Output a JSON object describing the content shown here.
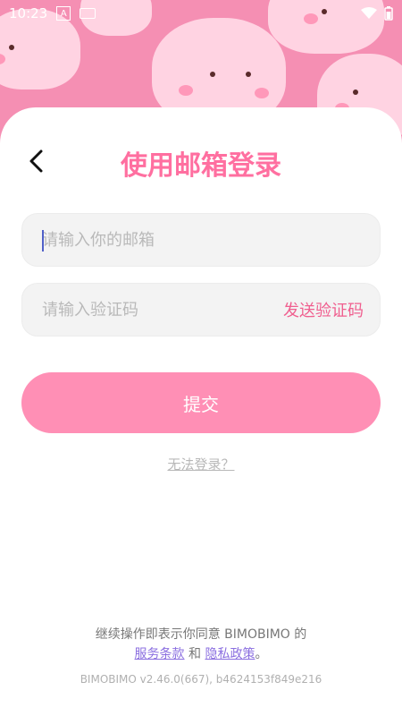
{
  "status_bar": {
    "time": "10:23",
    "a_icon": "A"
  },
  "header": {
    "title": "使用邮箱登录",
    "back_icon": "chevron-left-icon"
  },
  "form": {
    "email_placeholder": "请输入你的邮箱",
    "code_placeholder": "请输入验证码",
    "send_code_label": "发送验证码",
    "submit_label": "提交"
  },
  "links": {
    "cant_login": "无法登录？"
  },
  "footer": {
    "terms_prefix": "继续操作即表示你同意 BIMOBIMO 的",
    "terms_of_service": "服务条款",
    "and": "和",
    "privacy_policy": "隐私政策",
    "terms_suffix": "。",
    "version": "BIMOBIMO v2.46.0(667), b4624153f849e216"
  },
  "colors": {
    "accent": "#ff6fa0",
    "button": "#ff8fb5",
    "link": "#8b6fe0",
    "header_bg": "#f58fb3"
  }
}
